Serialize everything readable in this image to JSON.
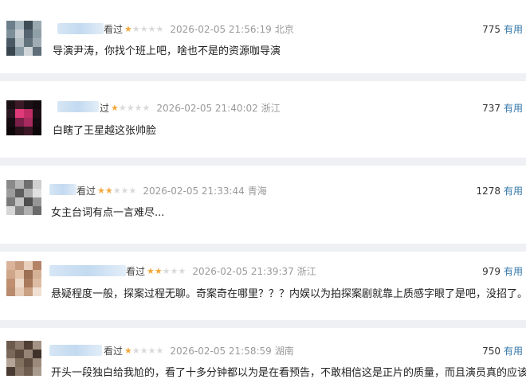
{
  "comments": [
    {
      "status": "看过",
      "rating": 1,
      "stars": "★",
      "stars_off": "★★★★",
      "time": "2026-02-05 21:56:19",
      "location": "北京",
      "votes": "775",
      "useful": "有用",
      "text": "导演尹涛，你找个班上吧，啥也不是的资源咖导演",
      "avatar_colors": [
        "#6b7e8a",
        "#a8b6bf",
        "#3f4d57",
        "#9aa8b0",
        "#7d8f98",
        "#c4ccd2",
        "#556470",
        "#8f9fa8",
        "#4a5964",
        "#b3bec5",
        "#63737e",
        "#a0acb3",
        "#38454f",
        "#889aa3",
        "#cfd6da",
        "#5e6d78"
      ]
    },
    {
      "status": "过",
      "rating": 1,
      "stars": "★",
      "stars_off": "★★★★",
      "time": "2026-02-05 21:40:02",
      "location": "浙江",
      "votes": "737",
      "useful": "有用",
      "text": "白瞎了王星越这张帅脸",
      "avatar_colors": [
        "#1a0f14",
        "#3a1a26",
        "#1c1016",
        "#120a0e",
        "#2b1520",
        "#e03a7a",
        "#c02d66",
        "#1d0e15",
        "#160b10",
        "#7a2048",
        "#a82a5e",
        "#140a0f",
        "#0e070a",
        "#261219",
        "#3b1725",
        "#0f080b"
      ]
    },
    {
      "status": "看过",
      "rating": 2,
      "stars": "★★",
      "stars_off": "★★★",
      "time": "2026-02-05 21:33:44",
      "location": "青海",
      "votes": "1278",
      "useful": "有用",
      "text": "女主台词有点一言难尽...",
      "avatar_colors": [
        "#8a8a8a",
        "#b5b5b5",
        "#6f6f6f",
        "#cfcfcf",
        "#9c9c9c",
        "#5e5e5e",
        "#aaaaaa",
        "#e0e0e0",
        "#7a7a7a",
        "#c2c2c2",
        "#4f4f4f",
        "#969696",
        "#d6d6d6",
        "#858585",
        "#b0b0b0",
        "#6a6a6a"
      ]
    },
    {
      "status": "看过",
      "rating": 2,
      "stars": "★★",
      "stars_off": "★★★",
      "time": "2026-02-05 21:39:37",
      "location": "浙江",
      "votes": "979",
      "useful": "有用",
      "text": "悬疑程度一般，探案过程无聊。奇案奇在哪里？？？内娱以为拍探案剧就靠上质感字眼了是吧，没招了。",
      "avatar_colors": [
        "#d9b49a",
        "#c79c7e",
        "#e8d0bd",
        "#b48366",
        "#cfa689",
        "#e3c2a8",
        "#9e7053",
        "#d4b095",
        "#c08f70",
        "#edd9c8",
        "#a97a5c",
        "#dcbca3",
        "#b98b6d",
        "#e6ccb6",
        "#c9a183",
        "#f0e0d2"
      ]
    },
    {
      "status": "看过",
      "rating": 1,
      "stars": "★",
      "stars_off": "★★★★",
      "time": "2026-02-05 21:58:59",
      "location": "湖南",
      "votes": "750",
      "useful": "有用",
      "text": "开头一段独白给我尬的，看了十多分钟都以为是在看预告，不敢相信这是正片的质量，而且演员真的应该要",
      "avatar_colors": [
        "#6d5a4e",
        "#8c7a6d",
        "#4f3f35",
        "#a39385",
        "#7a685b",
        "#5c4a3f",
        "#968476",
        "#3f322a",
        "#b3a497",
        "#82705f",
        "#604e42",
        "#9b8a7c",
        "#4a3b32",
        "#8a7868",
        "#6f5d50",
        "#a89a8d"
      ]
    }
  ]
}
